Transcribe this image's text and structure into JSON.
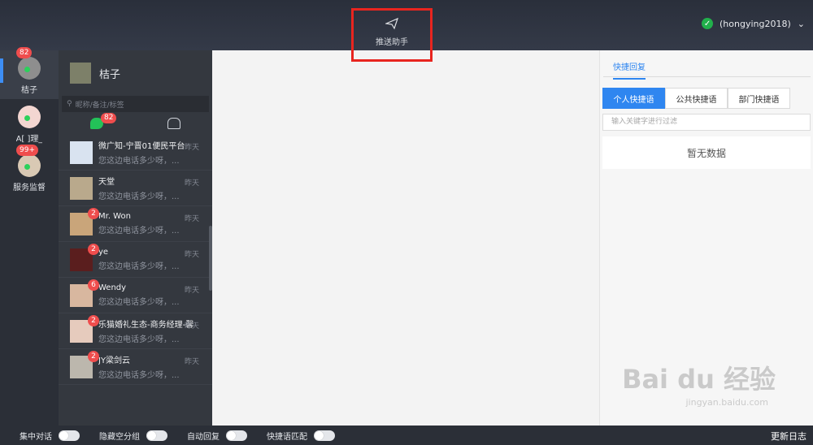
{
  "top": {
    "push_helper": "推送助手",
    "account": "(hongying2018)"
  },
  "accounts": [
    {
      "name": "桔子",
      "badge": "82",
      "active": true
    },
    {
      "name": "A[ ]理_",
      "badge": "",
      "active": false
    },
    {
      "name": "服务监督",
      "badge": "99+",
      "active": false
    }
  ],
  "contacts": {
    "header_name": "桔子",
    "search_placeholder": "昵称/备注/标签",
    "chat_badge": "82",
    "items": [
      {
        "name": "微广知-宁晋01便民平台",
        "msg": "您这边电话多少呀，...",
        "time": "昨天",
        "unread": ""
      },
      {
        "name": "天堂",
        "msg": "您这边电话多少呀，...",
        "time": "昨天",
        "unread": ""
      },
      {
        "name": "Mr. Won",
        "msg": "您这边电话多少呀，...",
        "time": "昨天",
        "unread": "2"
      },
      {
        "name": "ye",
        "msg": "您这边电话多少呀，...",
        "time": "昨天",
        "unread": "2"
      },
      {
        "name": "Wendy",
        "msg": "您这边电话多少呀，...",
        "time": "昨天",
        "unread": "6"
      },
      {
        "name": "乐猫婚礼生态-商务经理-馨",
        "msg": "您这边电话多少呀，...",
        "time": "昨天",
        "unread": "2"
      },
      {
        "name": "JY梁剑云",
        "msg": "您这边电话多少呀，...",
        "time": "昨天",
        "unread": "2"
      }
    ]
  },
  "right": {
    "tab": "快捷回复",
    "seg": [
      "个人快捷语",
      "公共快捷语",
      "部门快捷语"
    ],
    "filter_placeholder": "输入关键字进行过滤",
    "empty": "暂无数据"
  },
  "bottom": {
    "toggles": [
      "集中对话",
      "隐藏空分组",
      "自动回复",
      "快捷语匹配"
    ],
    "logs": "更新日志"
  },
  "watermark": {
    "main": "Bai du 经验",
    "sub": "jingyan.baidu.com"
  }
}
